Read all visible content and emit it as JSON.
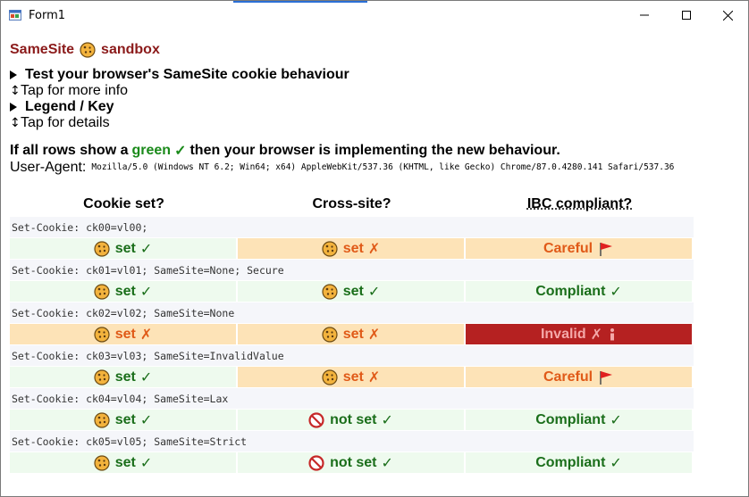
{
  "window": {
    "title": "Form1"
  },
  "page": {
    "heading_part1": "SameSite",
    "heading_part2": "sandbox",
    "test_summary": "Test your browser's SameSite cookie behaviour",
    "tap_more": "Tap for more info",
    "legend_summary": "Legend / Key",
    "tap_details": "Tap for details",
    "statement_pre": "If all rows show a",
    "statement_green": "green",
    "statement_check": "✓",
    "statement_post": "then your browser is implementing the new behaviour.",
    "ua_label": "User-Agent:",
    "ua_value": "Mozilla/5.0 (Windows NT 6.2; Win64; x64) AppleWebKit/537.36 (KHTML, like Gecko) Chrome/87.0.4280.141 Safari/537.36"
  },
  "table": {
    "headers": [
      "Cookie set?",
      "Cross-site?",
      "IBC compliant?"
    ],
    "rows": [
      {
        "set_cookie": "Set-Cookie: ck00=vl00;",
        "cookie_set": {
          "text": "set",
          "mark": "✓",
          "status": "ok"
        },
        "cross_site": {
          "text": "set",
          "mark": "✗",
          "status": "warn"
        },
        "ibc": {
          "text": "Careful",
          "status": "warn",
          "icon": "red-flag-icon"
        }
      },
      {
        "set_cookie": "Set-Cookie: ck01=vl01; SameSite=None; Secure",
        "cookie_set": {
          "text": "set",
          "mark": "✓",
          "status": "ok"
        },
        "cross_site": {
          "text": "set",
          "mark": "✓",
          "status": "ok"
        },
        "ibc": {
          "text": "Compliant",
          "mark": "✓",
          "status": "ok"
        }
      },
      {
        "set_cookie": "Set-Cookie: ck02=vl02; SameSite=None",
        "cookie_set": {
          "text": "set",
          "mark": "✗",
          "status": "warn"
        },
        "cross_site": {
          "text": "set",
          "mark": "✗",
          "status": "warn"
        },
        "ibc": {
          "text": "Invalid",
          "mark": "✗",
          "status": "bad",
          "icon": "info-icon"
        }
      },
      {
        "set_cookie": "Set-Cookie: ck03=vl03; SameSite=InvalidValue",
        "cookie_set": {
          "text": "set",
          "mark": "✓",
          "status": "ok"
        },
        "cross_site": {
          "text": "set",
          "mark": "✗",
          "status": "warn"
        },
        "ibc": {
          "text": "Careful",
          "status": "warn",
          "icon": "red-flag-icon"
        }
      },
      {
        "set_cookie": "Set-Cookie: ck04=vl04; SameSite=Lax",
        "cookie_set": {
          "text": "set",
          "mark": "✓",
          "status": "ok"
        },
        "cross_site": {
          "text": "not set",
          "mark": "✓",
          "status": "ok",
          "icon": "no-entry-icon"
        },
        "ibc": {
          "text": "Compliant",
          "mark": "✓",
          "status": "ok"
        }
      },
      {
        "set_cookie": "Set-Cookie: ck05=vl05; SameSite=Strict",
        "cookie_set": {
          "text": "set",
          "mark": "✓",
          "status": "ok"
        },
        "cross_site": {
          "text": "not set",
          "mark": "✓",
          "status": "ok",
          "icon": "no-entry-icon"
        },
        "ibc": {
          "text": "Compliant",
          "mark": "✓",
          "status": "ok"
        }
      }
    ]
  },
  "colors": {
    "heading": "#8b1a1a",
    "ok_bg": "#eefaee",
    "ok_text": "#1a6e1a",
    "warn_bg": "#fde3b7",
    "warn_text": "#e05a18",
    "bad_bg": "#b52121",
    "bad_text": "#f4a8a8"
  }
}
